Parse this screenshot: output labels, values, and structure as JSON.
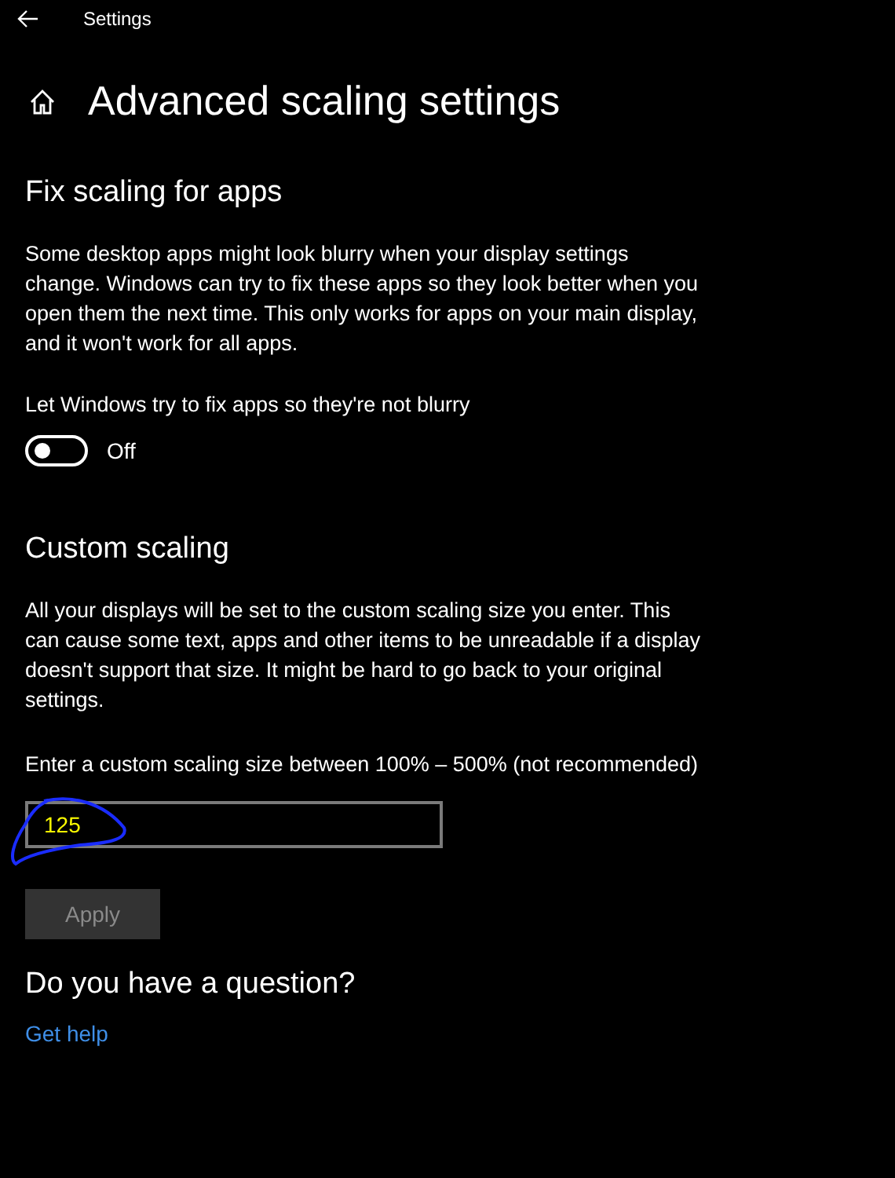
{
  "window": {
    "title": "Settings"
  },
  "page_title": "Advanced scaling settings",
  "fix_scaling": {
    "heading": "Fix scaling for apps",
    "description": "Some desktop apps might look blurry when your display settings change. Windows can try to fix these apps so they look better when you open them the next time. This only works for apps on your main display, and it won't work for all apps.",
    "toggle_label": "Let Windows try to fix apps so they're not blurry",
    "toggle_on": false,
    "toggle_state": "Off"
  },
  "custom_scaling": {
    "heading": "Custom scaling",
    "description": "All your displays will be set to the custom scaling size you enter. This can cause some text, apps and other items to be unreadable if a display doesn't support that size. It might be hard to go back to your original settings.",
    "field_label": "Enter a custom scaling size between 100% – 500% (not recommended)",
    "field_value": "125",
    "apply_button": "Apply",
    "apply_disabled": true
  },
  "help": {
    "heading": "Do you have a question?",
    "link": "Get help"
  }
}
